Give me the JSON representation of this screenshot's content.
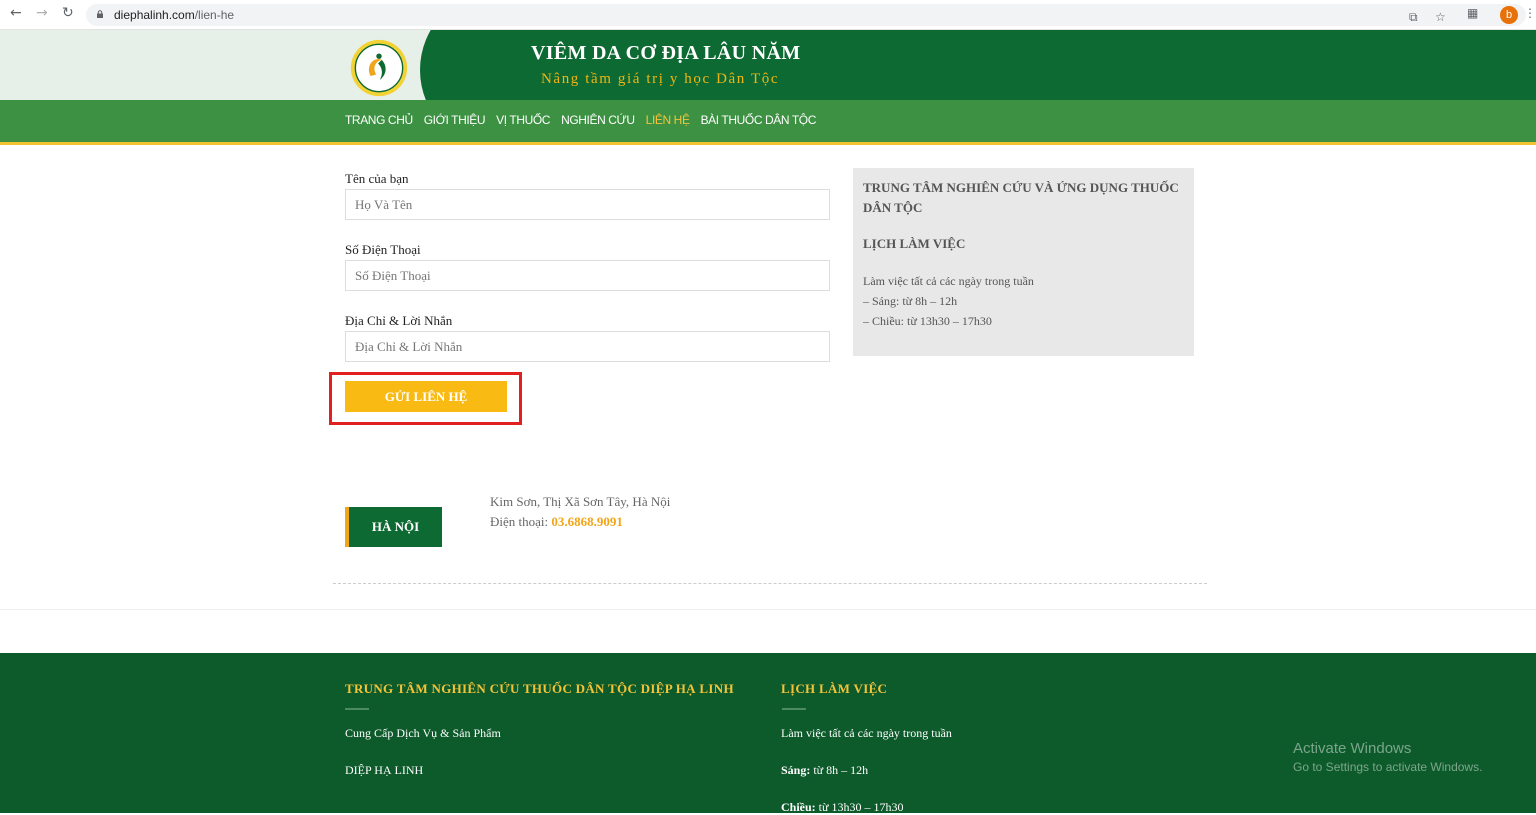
{
  "browser": {
    "url_host": "diephalinh.com",
    "url_path": "/lien-he",
    "avatar_letter": "b"
  },
  "header": {
    "title": "VIÊM DA CƠ ĐỊA LÂU NĂM",
    "tagline": "Nâng tầm giá trị y học Dân Tộc"
  },
  "menu": {
    "items": [
      {
        "label": "TRANG CHỦ"
      },
      {
        "label": "GIỚI THIỆU"
      },
      {
        "label": "VỊ THUỐC"
      },
      {
        "label": "NGHIÊN CỨU"
      },
      {
        "label": "LIÊN HỆ",
        "active": true
      },
      {
        "label": "BÀI THUỐC DÂN TỘC"
      }
    ]
  },
  "form": {
    "name_label": "Tên của bạn",
    "name_placeholder": "Họ Và Tên",
    "phone_label": "Số Điện Thoại",
    "phone_placeholder": "Số Điện Thoại",
    "address_label": "Địa Chỉ & Lời Nhắn",
    "address_placeholder": "Địa Chỉ & Lời Nhắn",
    "submit_label": "GỬI LIÊN HỆ"
  },
  "infobox": {
    "title": "TRUNG TÂM NGHIÊN CỨU VÀ ỨNG DỤNG THUỐC DÂN TỘC",
    "schedule_heading": "LỊCH LÀM VIỆC",
    "line1": "Làm việc tất cả các ngày trong tuần",
    "line2": "– Sáng: từ 8h – 12h",
    "line3": "– Chiều: từ 13h30 – 17h30"
  },
  "location": {
    "city": "HÀ NỘI",
    "address": "Kim Sơn, Thị Xã Sơn Tây, Hà Nội",
    "phone_label": "Điện thoại: ",
    "phone": "03.6868.9091"
  },
  "footer": {
    "col1_title": "TRUNG TÂM NGHIÊN CỨU THUỐC DÂN TỘC DIỆP HẠ LINH",
    "col1_line1": "Cung Cấp Dịch Vụ & Sản Phẩm",
    "col1_line2": "DIỆP HẠ LINH",
    "col2_title": "LỊCH LÀM VIỆC",
    "col2_line1": "Làm việc tất cả các ngày trong tuần",
    "col2_morning_label": "Sáng:",
    "col2_morning": " từ 8h – 12h",
    "col2_afternoon_label": "Chiều:",
    "col2_afternoon": " từ 13h30 – 17h30"
  },
  "watermark": {
    "line1": "Activate Windows",
    "line2": "Go to Settings to activate Windows."
  },
  "colors": {
    "header_green": "#0e6a33",
    "menu_green": "#3c9142",
    "accent_yellow": "#f9bb13",
    "highlight_red": "#e32020"
  }
}
